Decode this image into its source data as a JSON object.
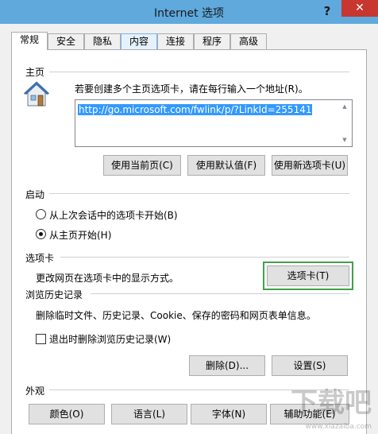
{
  "window": {
    "title": "Internet 选项",
    "help_label": "?",
    "close_label": "✕"
  },
  "tabs": [
    {
      "label": "常规",
      "active": true
    },
    {
      "label": "安全"
    },
    {
      "label": "隐私"
    },
    {
      "label": "内容"
    },
    {
      "label": "连接"
    },
    {
      "label": "程序"
    },
    {
      "label": "高级"
    }
  ],
  "home": {
    "title": "主页",
    "description": "若要创建多个主页选项卡，请在每行输入一个地址(R)。",
    "url": "http://go.microsoft.com/fwlink/p/?LinkId=255141",
    "buttons": {
      "use_current": "使用当前页(C)",
      "use_default": "使用默认值(F)",
      "use_new_tab": "使用新选项卡(U)"
    }
  },
  "startup": {
    "title": "启动",
    "option_last_session": "从上次会话中的选项卡开始(B)",
    "option_home": "从主页开始(H)",
    "selected": "option_home"
  },
  "tabs_section": {
    "title": "选项卡",
    "description": "更改网页在选项卡中的显示方式。",
    "button": "选项卡(T)"
  },
  "history": {
    "title": "浏览历史记录",
    "description": "删除临时文件、历史记录、Cookie、保存的密码和网页表单信息。",
    "checkbox_label": "退出时删除浏览历史记录(W)",
    "checkbox_checked": false,
    "delete_button": "删除(D)...",
    "settings_button": "设置(S)"
  },
  "appearance": {
    "title": "外观",
    "buttons": {
      "colors": "颜色(O)",
      "languages": "语言(L)",
      "fonts": "字体(N)",
      "accessibility": "辅助功能(E)"
    }
  },
  "watermark": {
    "text": "下载吧",
    "url": "www.xiazaiba.com"
  },
  "colors": {
    "titlebar": "#5fa9dd",
    "close": "#c7372f",
    "selection": "#3399ff",
    "highlight_frame": "#43a047"
  }
}
